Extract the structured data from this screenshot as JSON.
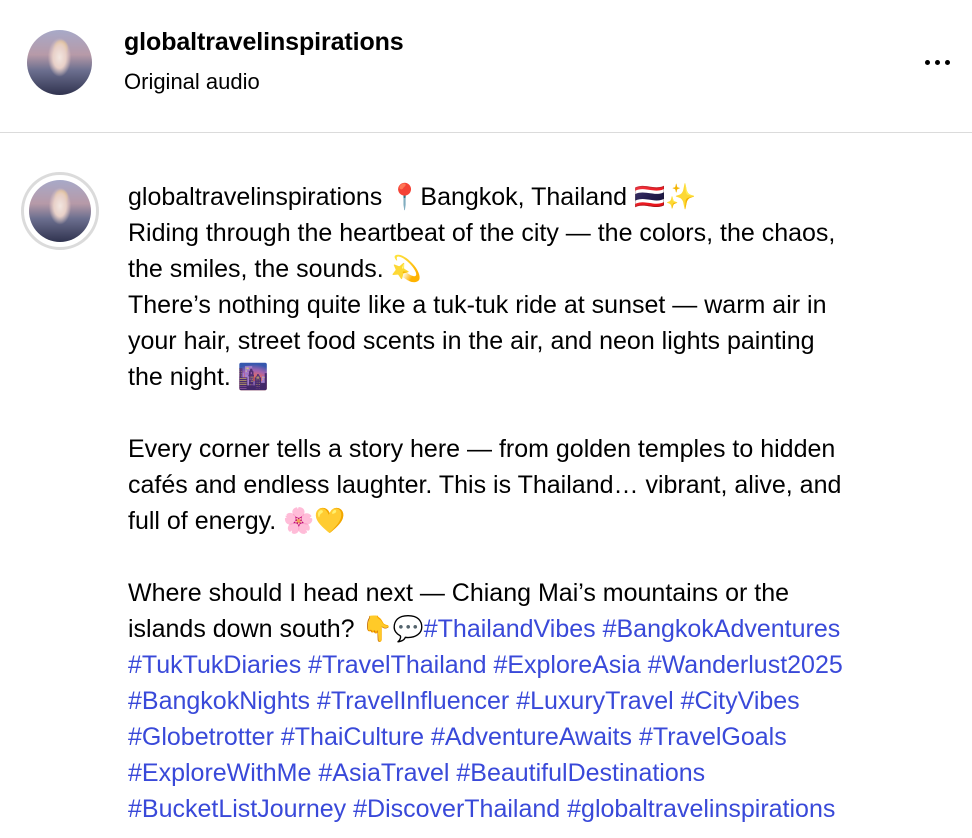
{
  "header": {
    "username": "globaltravelinspirations",
    "subtitle": "Original audio"
  },
  "caption": {
    "username": "globaltravelinspirations",
    "location": "📍Bangkok, Thailand 🇹🇭✨",
    "lines": [
      "Riding through the heartbeat of the city — the colors, the chaos,",
      "the smiles, the sounds. 💫",
      "There’s nothing quite like a tuk-tuk ride at sunset — warm air in",
      "your hair, street food scents in the air, and neon lights painting",
      "the night. 🌆",
      "",
      "Every corner tells a story here — from golden temples to hidden",
      "cafés and endless laughter. This is Thailand… vibrant, alive, and",
      "full of energy. 🌸💛",
      "",
      "Where should I head next — Chiang Mai’s mountains or the"
    ],
    "last_text": "islands down south? 👇💬",
    "hashtags": [
      "#ThailandVibes",
      "#BangkokAdventures",
      "#TukTukDiaries",
      "#TravelThailand",
      "#ExploreAsia",
      "#Wanderlust2025",
      "#BangkokNights",
      "#TravelInfluencer",
      "#LuxuryTravel",
      "#CityVibes",
      "#Globetrotter",
      "#ThaiCulture",
      "#AdventureAwaits",
      "#TravelGoals",
      "#ExploreWithMe",
      "#AsiaTravel",
      "#BeautifulDestinations",
      "#BucketListJourney",
      "#DiscoverThailand",
      "#globaltravelinspirations"
    ]
  },
  "colors": {
    "hashtag": "#3949d9",
    "divider": "#dbdbdb",
    "text": "#000000"
  },
  "icons": {
    "more": "more-options-icon"
  }
}
